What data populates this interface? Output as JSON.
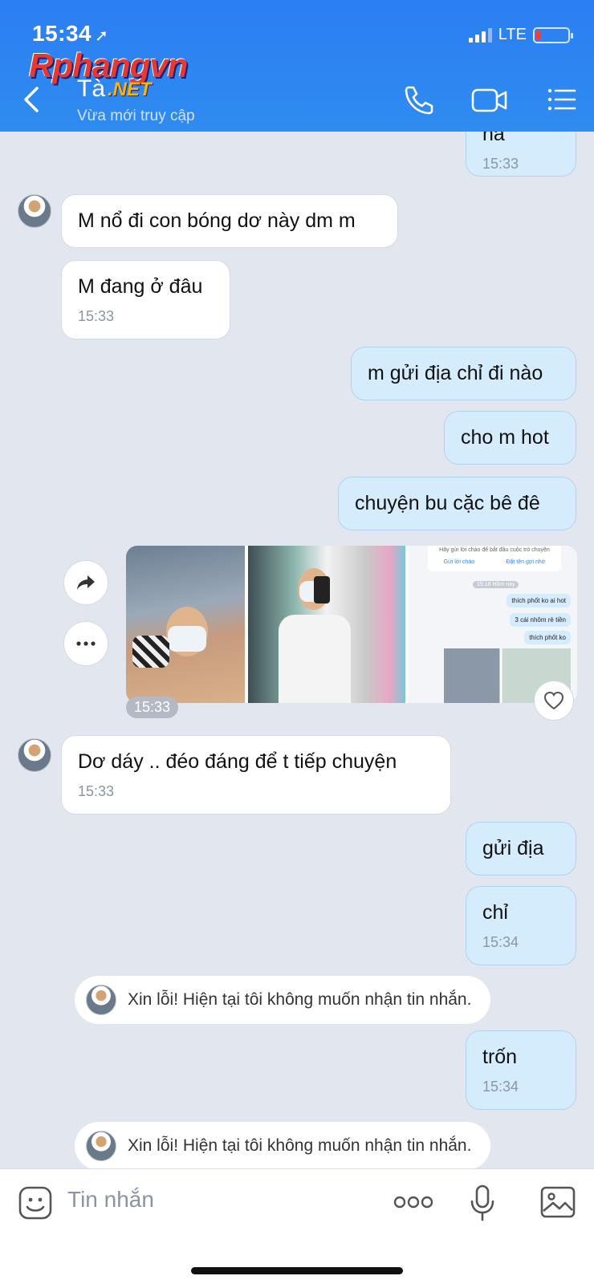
{
  "status_bar": {
    "time": "15:34",
    "network": "LTE"
  },
  "watermark": {
    "brand": "Rphangvn",
    "suffix": ".NET"
  },
  "header": {
    "contact_name": "Tà",
    "contact_status": "Vừa mới truy cập",
    "icons": [
      "back-icon",
      "phone-icon",
      "video-call-icon",
      "menu-list-icon"
    ]
  },
  "messages": {
    "m0": {
      "text": "ha",
      "time": "15:33"
    },
    "m1": {
      "text": "M nổ đi con bóng dơ này dm m"
    },
    "m2": {
      "text": "M đang ở đâu",
      "time": "15:33"
    },
    "m3": {
      "text": "m gửi địa chỉ đi nào"
    },
    "m4": {
      "text": "cho m hot"
    },
    "m5": {
      "text": "chuyện bu cặc bê đê"
    },
    "album": {
      "time": "15:33",
      "screenshot_text": {
        "greeting": "Hãy gửi lời chào để bắt đầu cuộc trò chuyện",
        "greet_btn": "Gửi lời chào",
        "nickname_btn": "Đặt tên gợi nhớ",
        "day_label": "15:18 Hôm nay",
        "msg1": "thích phốt ko ai hot",
        "msg2": "3 cái nhôm rẻ tiền",
        "msg3": "thích phốt ko"
      }
    },
    "m6": {
      "text": "Dơ dáy .. đéo đáng để t tiếp chuyện",
      "time": "15:33"
    },
    "m7": {
      "text": "gửi địa"
    },
    "m8": {
      "text": "chỉ",
      "time": "15:34"
    },
    "sys1": {
      "text": "Xin lỗi! Hiện tại tôi không muốn nhận tin nhắn."
    },
    "m9": {
      "text": "trốn",
      "time": "15:34"
    },
    "sys2": {
      "text": "Xin lỗi! Hiện tại tôi không muốn nhận tin nhắn."
    }
  },
  "composer": {
    "placeholder": "Tin nhắn",
    "icons": [
      "sticker-icon",
      "more-icon",
      "microphone-icon",
      "image-icon"
    ]
  },
  "colors": {
    "header": "#2f86f1",
    "outgoing_bubble": "#d5ecfd",
    "incoming_bubble": "#ffffff",
    "background": "#e2e7ef"
  }
}
